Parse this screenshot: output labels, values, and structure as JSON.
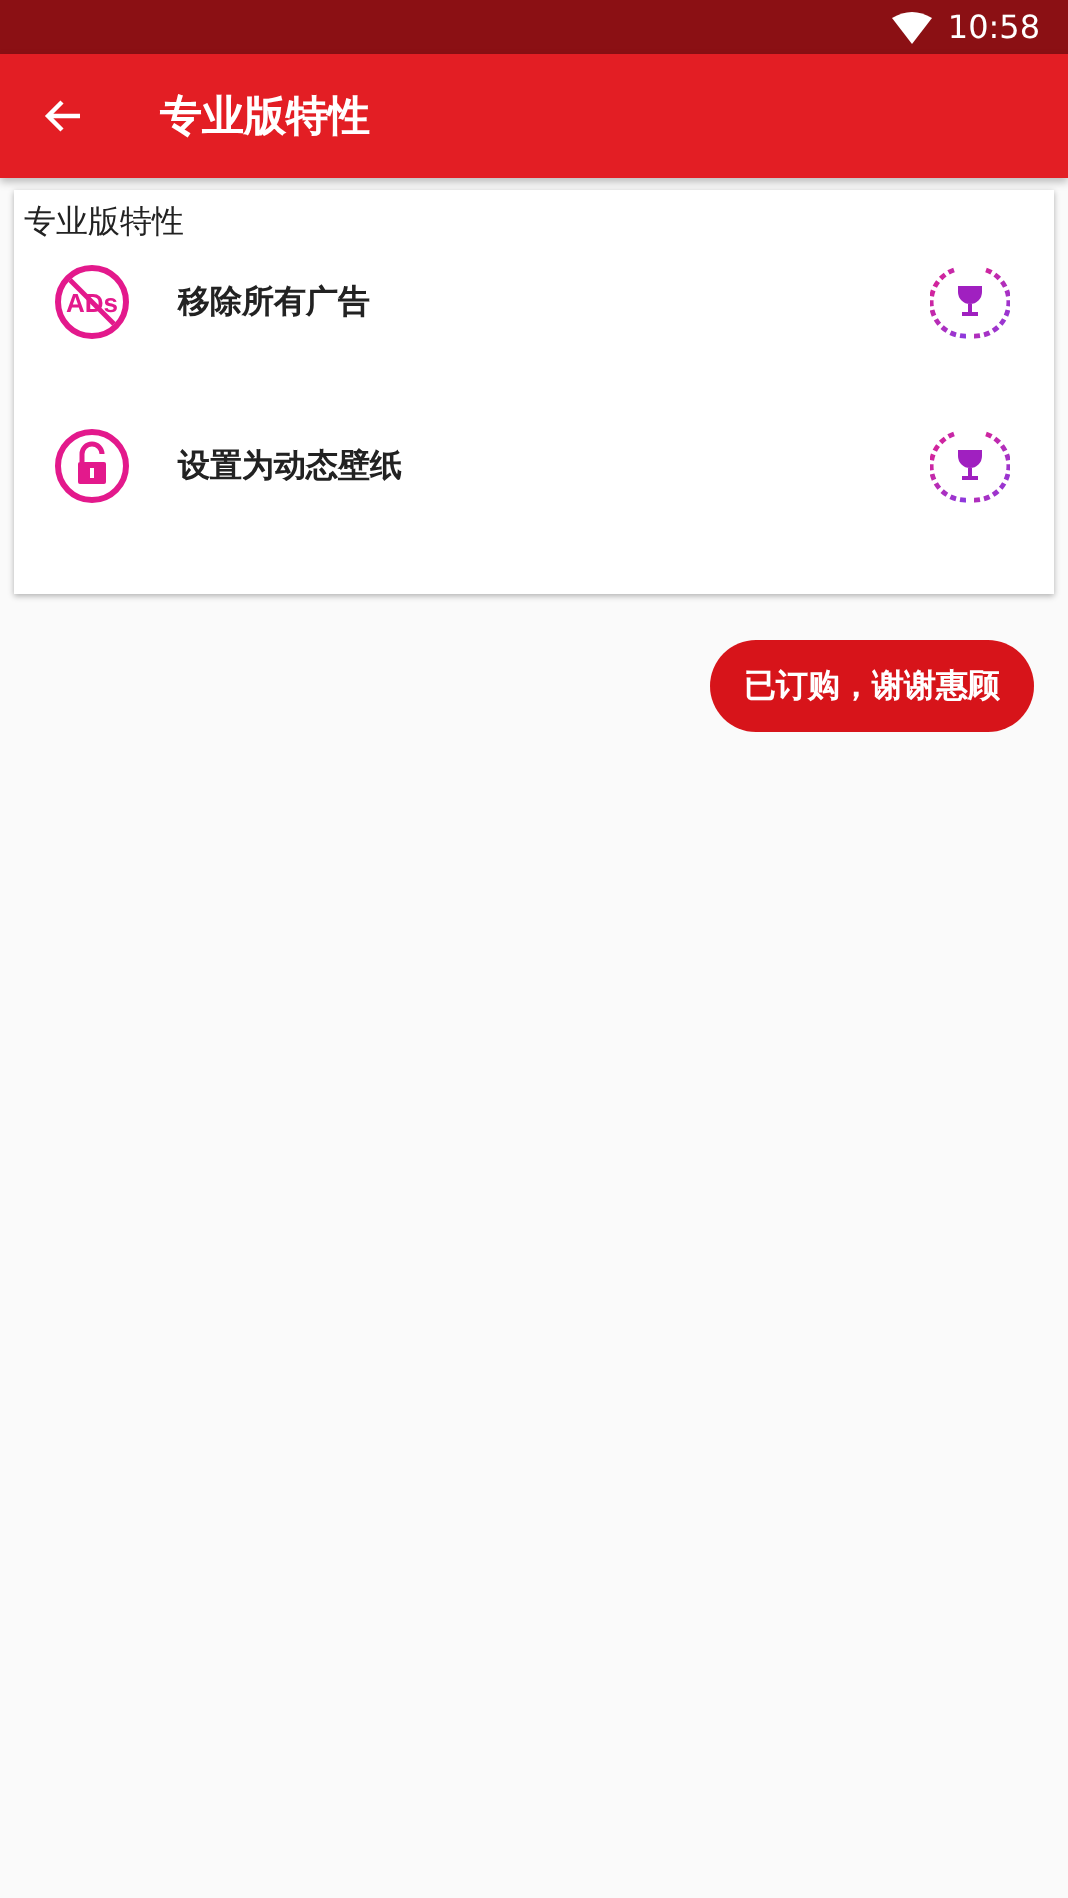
{
  "status_bar": {
    "time": "10:58"
  },
  "app_bar": {
    "title": "专业版特性"
  },
  "card": {
    "title": "专业版特性",
    "features": [
      {
        "kind": "no-ads",
        "icon_label": "ADs",
        "label": "移除所有广告"
      },
      {
        "kind": "lock",
        "label": "设置为动态壁纸"
      }
    ]
  },
  "button": {
    "label": "已订购，谢谢惠顾"
  }
}
